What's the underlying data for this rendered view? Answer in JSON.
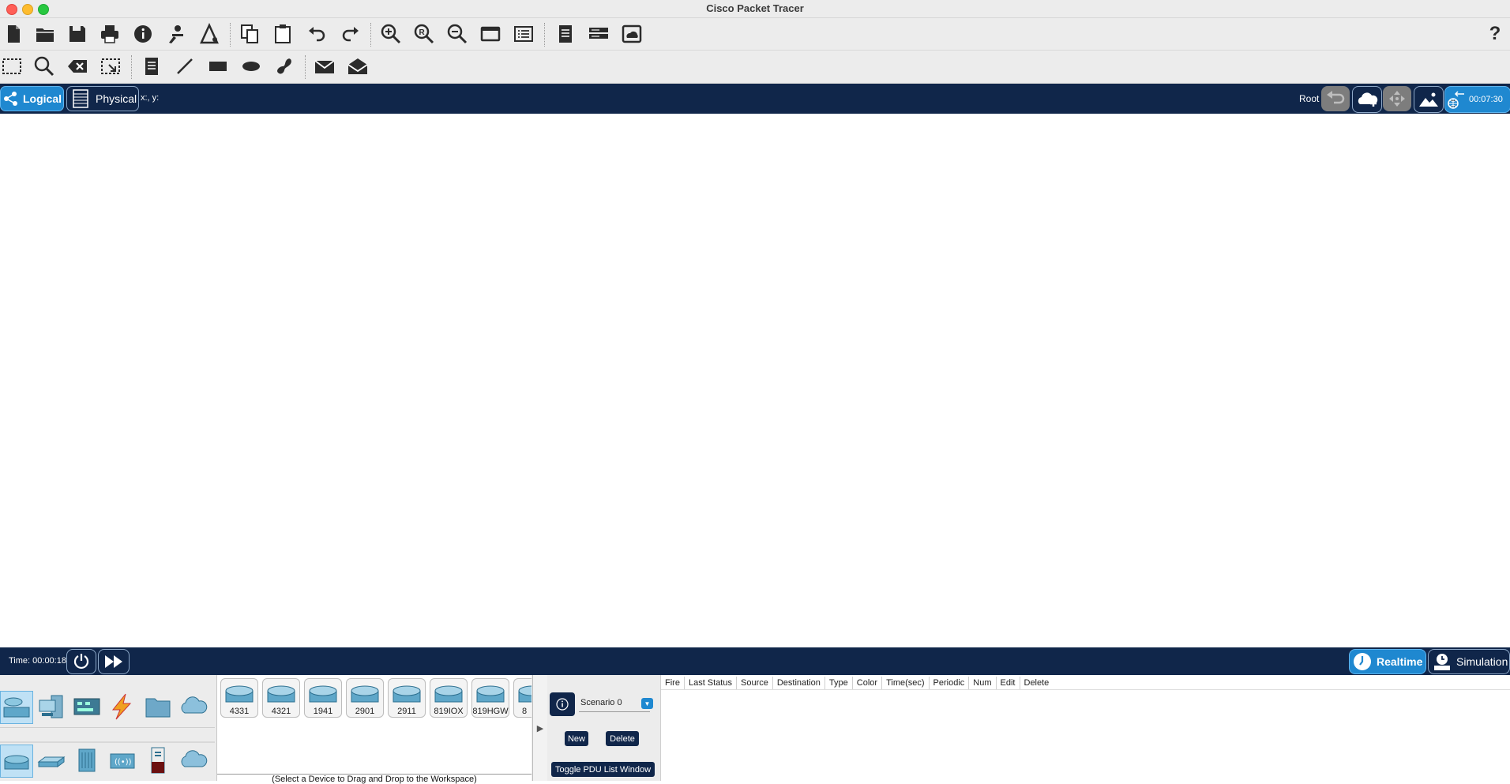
{
  "window": {
    "title": "Cisco Packet Tracer"
  },
  "toolbar_main": {
    "items": [
      "new-file-icon",
      "open-folder-icon",
      "save-icon",
      "print-icon",
      "info-icon",
      "activity-wizard-icon",
      "custom-device-icon",
      "copy-icon",
      "paste-icon",
      "undo-icon",
      "redo-icon",
      "zoom-in-icon",
      "zoom-reset-icon",
      "zoom-out-icon",
      "drawing-palette-icon",
      "custom-devices-dialog-icon",
      "notes-icon",
      "device-template-icon",
      "cloud-image-icon",
      "help-icon"
    ],
    "help_label": "?"
  },
  "toolbar_tools": {
    "items": [
      "select-icon",
      "inspect-icon",
      "delete-icon",
      "resize-shape-icon",
      "place-note-icon",
      "draw-line-icon",
      "draw-rectangle-icon",
      "draw-ellipse-icon",
      "draw-freeform-icon",
      "add-simple-pdu-icon",
      "add-complex-pdu-icon"
    ]
  },
  "nav": {
    "logical_label": "Logical",
    "physical_label": "Physical",
    "coords_label": "x:, y:",
    "root_label": "Root",
    "clock": "00:07:30"
  },
  "sim": {
    "time_label": "Time: 00:00:18",
    "realtime_label": "Realtime",
    "simulation_label": "Simulation"
  },
  "devices": {
    "items": [
      {
        "label": "4331"
      },
      {
        "label": "4321"
      },
      {
        "label": "1941"
      },
      {
        "label": "2901"
      },
      {
        "label": "2911"
      },
      {
        "label": "819IOX"
      },
      {
        "label": "819HGW"
      },
      {
        "label": "8"
      }
    ],
    "status_text": "(Select a Device to Drag and Drop to the Workspace)"
  },
  "scenario": {
    "selected": "Scenario 0",
    "new_label": "New",
    "delete_label": "Delete",
    "toggle_label": "Toggle PDU List Window"
  },
  "pdu_columns": [
    "Fire",
    "Last Status",
    "Source",
    "Destination",
    "Type",
    "Color",
    "Time(sec)",
    "Periodic",
    "Num",
    "Edit",
    "Delete"
  ],
  "colors": {
    "navy": "#10264a",
    "accent": "#1f88d0",
    "router": "#5fa7c9"
  }
}
